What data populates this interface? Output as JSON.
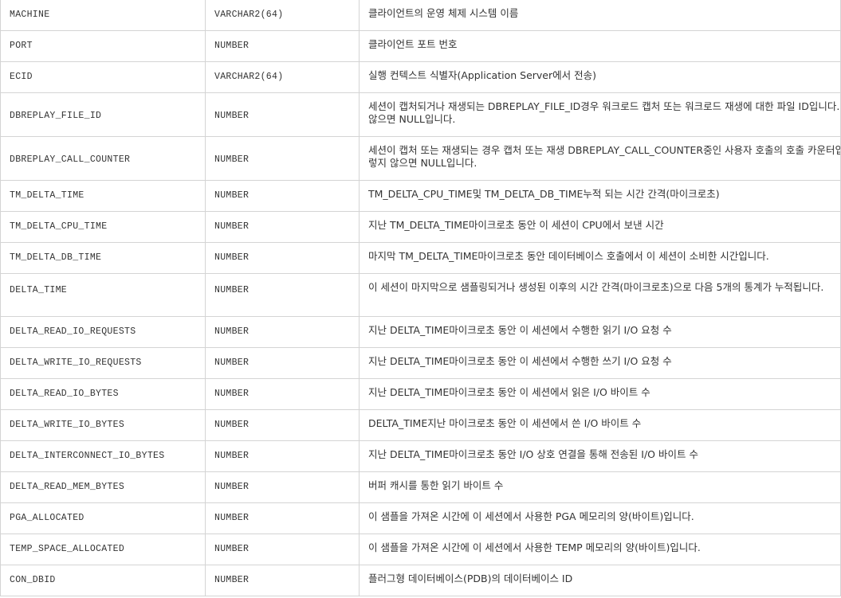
{
  "table": {
    "rows": [
      {
        "column": "MACHINE",
        "datatype": "VARCHAR2(64)",
        "description": "클라이언트의 운영 체제 시스템 이름",
        "tall": false
      },
      {
        "column": "PORT",
        "datatype": "NUMBER",
        "description": "클라이언트 포트 번호",
        "tall": false
      },
      {
        "column": "ECID",
        "datatype": "VARCHAR2(64)",
        "description": "실행 컨텍스트 식별자(Application Server에서 전송)",
        "tall": false
      },
      {
        "column": "DBREPLAY_FILE_ID",
        "datatype": "NUMBER",
        "description": "세션이 캡처되거나 재생되는 DBREPLAY_FILE_ID경우 워크로드 캡처 또는 워크로드 재생에 대한 파일 ID입니다. 그렇지 않으면 NULL입니다.",
        "tall": true
      },
      {
        "column": "DBREPLAY_CALL_COUNTER",
        "datatype": "NUMBER",
        "description": "세션이 캡처 또는 재생되는 경우 캡처 또는 재생 DBREPLAY_CALL_COUNTER중인 사용자 호출의 호출 카운터입니다. 그렇지 않으면 NULL입니다.",
        "tall": true
      },
      {
        "column": "TM_DELTA_TIME",
        "datatype": "NUMBER",
        "description": "TM_DELTA_CPU_TIME및 TM_DELTA_DB_TIME누적 되는 시간 간격(마이크로초)",
        "tall": false
      },
      {
        "column": "TM_DELTA_CPU_TIME",
        "datatype": "NUMBER",
        "description": "지난 TM_DELTA_TIME마이크로초 동안 이 세션이 CPU에서 보낸 시간",
        "tall": false
      },
      {
        "column": "TM_DELTA_DB_TIME",
        "datatype": "NUMBER",
        "description": "마지막 TM_DELTA_TIME마이크로초 동안 데이터베이스 호출에서 이 세션이 소비한 시간입니다.",
        "tall": false
      },
      {
        "column": "DELTA_TIME",
        "datatype": "NUMBER",
        "description": "이 세션이 마지막으로 샘플링되거나 생성된 이후의 시간 간격(마이크로초)으로 다음 5개의 통계가 누적됩니다.",
        "tall": true
      },
      {
        "column": "DELTA_READ_IO_REQUESTS",
        "datatype": "NUMBER",
        "description": "지난 DELTA_TIME마이크로초 동안 이 세션에서 수행한 읽기 I/O 요청 수",
        "tall": false
      },
      {
        "column": "DELTA_WRITE_IO_REQUESTS",
        "datatype": "NUMBER",
        "description": "지난 DELTA_TIME마이크로초 동안 이 세션에서 수행한 쓰기 I/O 요청 수",
        "tall": false
      },
      {
        "column": "DELTA_READ_IO_BYTES",
        "datatype": "NUMBER",
        "description": "지난 DELTA_TIME마이크로초 동안 이 세션에서 읽은 I/O 바이트 수",
        "tall": false
      },
      {
        "column": "DELTA_WRITE_IO_BYTES",
        "datatype": "NUMBER",
        "description": "DELTA_TIME지난 마이크로초 동안 이 세션에서 쓴 I/O 바이트 수",
        "tall": false
      },
      {
        "column": "DELTA_INTERCONNECT_IO_BYTES",
        "datatype": "NUMBER",
        "description": "지난 DELTA_TIME마이크로초 동안 I/O 상호 연결을 통해 전송된 I/O 바이트 수",
        "tall": false
      },
      {
        "column": "DELTA_READ_MEM_BYTES",
        "datatype": "NUMBER",
        "description": "버퍼 캐시를 통한 읽기 바이트 수",
        "tall": false
      },
      {
        "column": "PGA_ALLOCATED",
        "datatype": "NUMBER",
        "description": "이 샘플을 가져온 시간에 이 세션에서 사용한 PGA 메모리의 양(바이트)입니다.",
        "tall": false
      },
      {
        "column": "TEMP_SPACE_ALLOCATED",
        "datatype": "NUMBER",
        "description": "이 샘플을 가져온 시간에 이 세션에서 사용한 TEMP 메모리의 양(바이트)입니다.",
        "tall": false
      },
      {
        "column": "CON_DBID",
        "datatype": "NUMBER",
        "description": "플러그형 데이터베이스(PDB)의 데이터베이스 ID",
        "tall": false
      }
    ]
  }
}
